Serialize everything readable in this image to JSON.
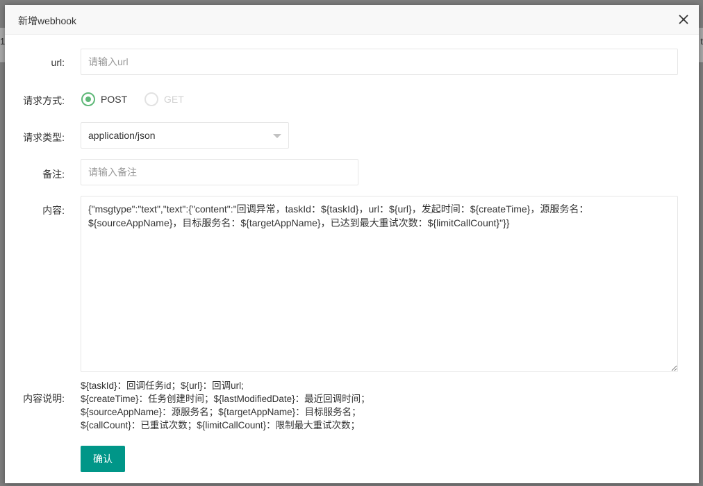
{
  "background": {
    "left_char": "1",
    "right_char": "t"
  },
  "dialog": {
    "title": "新增webhook",
    "close_icon": "close-icon"
  },
  "form": {
    "url": {
      "label": "url:",
      "value": "",
      "placeholder": "请输入url"
    },
    "method": {
      "label": "请求方式:",
      "options": [
        {
          "label": "POST",
          "checked": true,
          "disabled": false
        },
        {
          "label": "GET",
          "checked": false,
          "disabled": true
        }
      ]
    },
    "content_type": {
      "label": "请求类型:",
      "selected": "application/json"
    },
    "remark": {
      "label": "备注:",
      "value": "",
      "placeholder": "请输入备注"
    },
    "content": {
      "label": "内容:",
      "value": "{\"msgtype\":\"text\",\"text\":{\"content\":\"回调异常，taskId：${taskId}，url：${url}，发起时间：${createTime}，源服务名：${sourceAppName}，目标服务名：${targetAppName}，已达到最大重试次数：${limitCallCount}\"}}"
    },
    "content_desc": {
      "label": "内容说明:",
      "lines": [
        "${taskId}：回调任务id；${url}：回调url;",
        "${createTime}：任务创建时间；${lastModifiedDate}：最近回调时间；",
        "${sourceAppName}：源服务名；${targetAppName}：目标服务名；",
        "${callCount}：已重试次数；${limitCallCount}：限制最大重试次数；"
      ]
    },
    "submit_label": "确认"
  },
  "colors": {
    "accent": "#009688",
    "radio_checked": "#5fb878",
    "border": "#e6e6e6",
    "placeholder": "#999999"
  }
}
